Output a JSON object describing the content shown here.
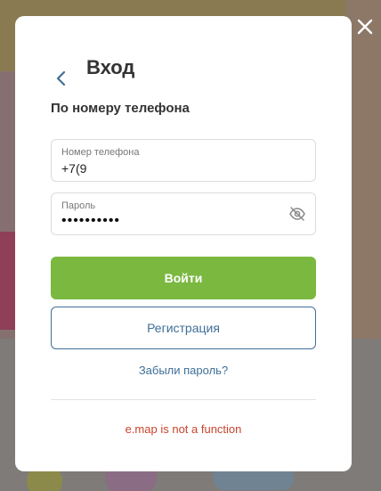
{
  "modal": {
    "title": "Вход",
    "subtitle": "По номеру телефона",
    "phone_field": {
      "label": "Номер телефона",
      "value": "+7(9"
    },
    "password_field": {
      "label": "Пароль",
      "masked_value": "••••••••••"
    },
    "login_button": "Войти",
    "register_button": "Регистрация",
    "forgot_link": "Забыли пароль?",
    "error_message": "e.map is not a function"
  },
  "colors": {
    "primary_green": "#7ab840",
    "link_blue": "#3f6f98",
    "error_red": "#c9452d",
    "overlay_dim": "#6f6a66"
  },
  "icons": {
    "back": "chevron-left-icon",
    "close": "close-icon",
    "password_visibility": "eye-off-icon"
  }
}
